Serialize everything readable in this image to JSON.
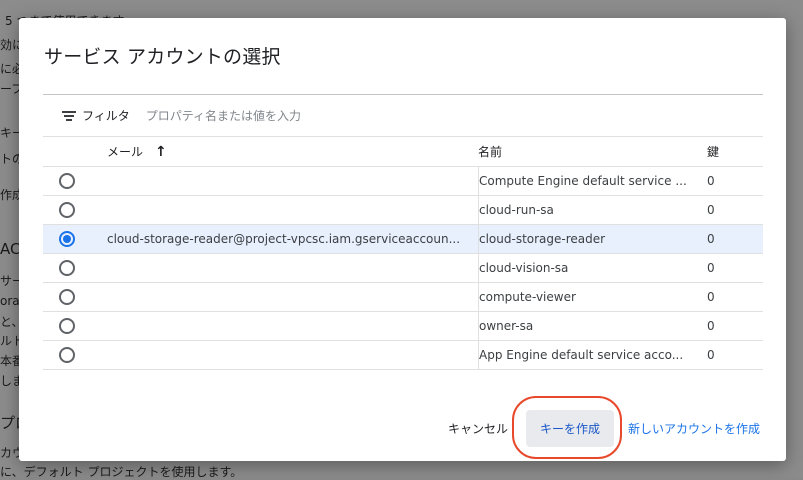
{
  "background": {
    "lines": [
      "5 つまで使用できます",
      "効に",
      "に必",
      "ープ",
      "キー",
      "トの",
      "作成",
      "AC",
      "サー",
      "orag",
      "と、",
      "ルト",
      "本番",
      "しま",
      "プロ",
      "カウ",
      "に、デフォルト プロジェクトを使用します。"
    ]
  },
  "dialog": {
    "title": "サービス アカウントの選択",
    "filter": {
      "label": "フィルタ",
      "placeholder": "プロパティ名または値を入力"
    },
    "columns": {
      "email": "メール",
      "name": "名前",
      "keys": "鍵"
    },
    "rows": [
      {
        "email": "",
        "name": "Compute Engine default service ...",
        "keys": "0",
        "selected": false
      },
      {
        "email": "",
        "name": "cloud-run-sa",
        "keys": "0",
        "selected": false
      },
      {
        "email": "cloud-storage-reader@project-vpcsc.iam.gserviceaccoun...",
        "name": "cloud-storage-reader",
        "keys": "0",
        "selected": true
      },
      {
        "email": "",
        "name": "cloud-vision-sa",
        "keys": "0",
        "selected": false
      },
      {
        "email": "",
        "name": "compute-viewer",
        "keys": "0",
        "selected": false
      },
      {
        "email": "",
        "name": "owner-sa",
        "keys": "0",
        "selected": false
      },
      {
        "email": "",
        "name": "App Engine default service acco...",
        "keys": "0",
        "selected": false
      }
    ],
    "actions": {
      "cancel": "キャンセル",
      "create_key": "キーを作成",
      "new_account": "新しいアカウントを作成"
    }
  },
  "colors": {
    "accent": "#1a73e8",
    "highlight": "#e8492c",
    "selected_row": "#e8f0fe"
  }
}
